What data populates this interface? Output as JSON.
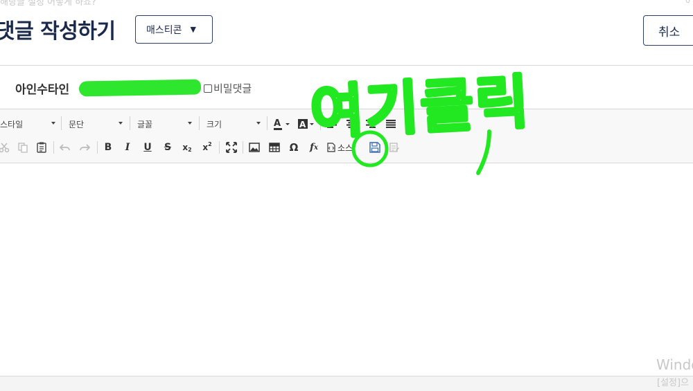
{
  "header": {
    "faded_top_text": "해당글 설정 어떻게 하죠?",
    "faded_top_right": "0",
    "title": "댓글 작성하기",
    "emoticon_label": "매스티콘",
    "cancel_label": "취소"
  },
  "author": {
    "name": "아인수타인",
    "secret_label": "비밀댓글"
  },
  "toolbar": {
    "combos": [
      {
        "label": "스타일"
      },
      {
        "label": "문단"
      },
      {
        "label": "글꼴"
      },
      {
        "label": "크기"
      }
    ],
    "source_label": "소스"
  },
  "annotation": {
    "handwritten_text": "여기클릭",
    "color": "#22e822"
  },
  "watermark": {
    "line1": "Windo",
    "line2": "[설정]으"
  }
}
